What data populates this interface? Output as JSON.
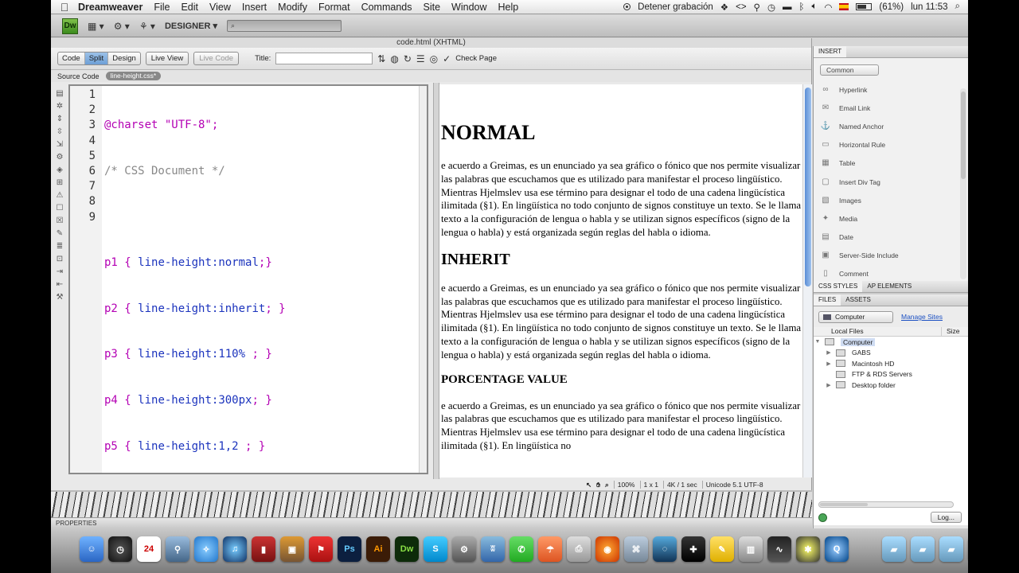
{
  "menubar": {
    "app_name": "Dreamweaver",
    "items": [
      "File",
      "Edit",
      "View",
      "Insert",
      "Modify",
      "Format",
      "Commands",
      "Site",
      "Window",
      "Help"
    ],
    "recording_label": "Detener grabación",
    "battery": "(61%)",
    "clock": "lun 11:53"
  },
  "appbar": {
    "logo": "Dw",
    "workspace": "DESIGNER ▾"
  },
  "document": {
    "title": "code.html (XHTML)",
    "view_buttons": [
      "Code",
      "Split",
      "Design"
    ],
    "active_view": "Split",
    "live_view": "Live View",
    "live_code": "Live Code",
    "title_label": "Title:",
    "title_value": "",
    "check_page": "Check Page",
    "source_code_label": "Source Code",
    "related_file": "line-height.css*"
  },
  "code": {
    "line_numbers": [
      "1",
      "2",
      "3",
      "4",
      "5",
      "6",
      "7",
      "8",
      "9"
    ],
    "lines": [
      {
        "sel": "@charset \"UTF-8\";",
        "rest": ""
      },
      {
        "cm": "/* CSS Document */"
      },
      {
        "sel": "",
        "rest": ""
      },
      {
        "sel": "p1 { ",
        "prop": "line-height:",
        "val": "normal",
        "end": ";}"
      },
      {
        "sel": "p2 { ",
        "prop": "line-height:",
        "val": "inherit",
        "end": "; }"
      },
      {
        "sel": "p3 { ",
        "prop": "line-height:",
        "val": "110%",
        "end": " ; }"
      },
      {
        "sel": "p4 { ",
        "prop": "line-height:",
        "val": "300px",
        "end": "; }"
      },
      {
        "sel": "p5 { ",
        "prop": "line-height:",
        "val": "1,2",
        "end": " ; }"
      },
      {
        "sel": "",
        "rest": ""
      }
    ]
  },
  "design": {
    "h1": "NORMAL",
    "p1": "e acuerdo a Greimas, es un enunciado ya sea gráfico o fónico que nos permite visualizar las palabras que escuchamos que es utilizado para manifestar el proceso lingüístico. Mientras Hjelmslev usa ese término para designar el todo de una cadena lingücística ilimitada (§1). En lingüística no todo conjunto de signos constituye un texto. Se le llama texto a la configuración de lengua o habla y se utilizan signos específicos (signo de la lengua o habla) y está organizada según reglas del habla o idioma.",
    "h2": "INHERIT",
    "p2": "e acuerdo a Greimas, es un enunciado ya sea gráfico o fónico que nos permite visualizar las palabras que escuchamos que es utilizado para manifestar el proceso lingüístico. Mientras Hjelmslev usa ese término para designar el todo de una cadena lingücística ilimitada (§1). En lingüística no todo conjunto de signos constituye un texto. Se le llama texto a la configuración de lengua o habla y se utilizan signos específicos (signo de la lengua o habla) y está organizada según reglas del habla o idioma.",
    "h3": "PORCENTAGE VALUE",
    "p3": "e acuerdo a Greimas, es un enunciado ya sea gráfico o fónico que nos permite visualizar las palabras que escuchamos que es utilizado para manifestar el proceso lingüístico. Mientras Hjelmslev usa ese término para designar el todo de una cadena lingücística ilimitada (§1). En lingüística no"
  },
  "status": {
    "zoom": "100%",
    "size": "1 x 1",
    "download": "4K / 1 sec",
    "encoding": "Unicode 5.1 UTF-8"
  },
  "properties_label": "PROPERTIES",
  "insert_panel": {
    "tab": "INSERT",
    "category": "Common",
    "items": [
      "Hyperlink",
      "Email Link",
      "Named Anchor",
      "Horizontal Rule",
      "Table",
      "Insert Div Tag",
      "Images",
      "Media",
      "Date",
      "Server-Side Include",
      "Comment"
    ]
  },
  "css_tabs": [
    "CSS STYLES",
    "AP ELEMENTS"
  ],
  "files_panel": {
    "tabs": [
      "FILES",
      "ASSETS"
    ],
    "site": "Computer",
    "manage_sites": "Manage Sites",
    "col_local": "Local Files",
    "col_size": "Size",
    "tree": [
      {
        "label": "Computer",
        "level": 0,
        "selected": true
      },
      {
        "label": "GABS",
        "level": 1
      },
      {
        "label": "Macintosh HD",
        "level": 1
      },
      {
        "label": "FTP & RDS Servers",
        "level": 1
      },
      {
        "label": "Desktop folder",
        "level": 1
      }
    ],
    "log_button": "Log..."
  },
  "dock": {
    "labels": [
      "24",
      "Ps",
      "Ai",
      "Dw"
    ]
  }
}
